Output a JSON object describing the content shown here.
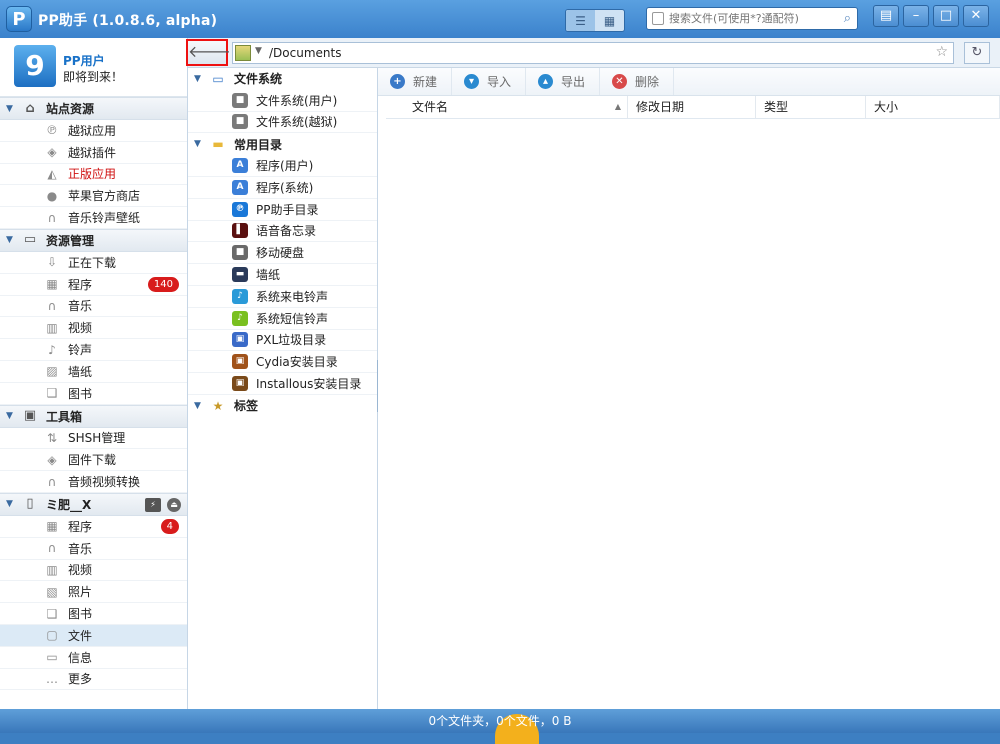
{
  "window": {
    "title": "PP助手 (1.0.8.6, alpha)",
    "logo": "P",
    "search_placeholder": "搜索文件(可使用*?通配符)",
    "controls": [
      "comment-icon",
      "minimize-icon",
      "maximize-icon",
      "close-icon"
    ]
  },
  "user": {
    "name": "PP用户",
    "status": "即将到来！"
  },
  "sidebar": {
    "sections": [
      {
        "title": "站点资源",
        "icon": "home-icon",
        "items": [
          {
            "label": "越狱应用",
            "icon": "pp-icon"
          },
          {
            "label": "越狱插件",
            "icon": "cube-icon"
          },
          {
            "label": "正版应用",
            "icon": "store-icon",
            "highlight": "red"
          },
          {
            "label": "苹果官方商店",
            "icon": "apple-icon"
          },
          {
            "label": "音乐铃声壁纸",
            "icon": "headphones-icon"
          }
        ]
      },
      {
        "title": "资源管理",
        "icon": "monitor-icon",
        "items": [
          {
            "label": "正在下载",
            "icon": "download-icon"
          },
          {
            "label": "程序",
            "icon": "apps-icon",
            "badge": "140"
          },
          {
            "label": "音乐",
            "icon": "headphones-icon"
          },
          {
            "label": "视频",
            "icon": "film-icon"
          },
          {
            "label": "铃声",
            "icon": "note-icon"
          },
          {
            "label": "墙纸",
            "icon": "picture-icon"
          },
          {
            "label": "图书",
            "icon": "book-icon"
          }
        ]
      },
      {
        "title": "工具箱",
        "icon": "toolbox-icon",
        "items": [
          {
            "label": "SHSH管理",
            "icon": "arrows-icon"
          },
          {
            "label": "固件下载",
            "icon": "cube-icon"
          },
          {
            "label": "音频视频转换",
            "icon": "headphones-icon"
          }
        ]
      },
      {
        "title": "ミ肥__X",
        "icon": "phone-icon",
        "device": true,
        "items": [
          {
            "label": "程序",
            "icon": "apps-icon",
            "badge": "4"
          },
          {
            "label": "音乐",
            "icon": "headphones-icon"
          },
          {
            "label": "视频",
            "icon": "film-icon"
          },
          {
            "label": "照片",
            "icon": "photo-icon"
          },
          {
            "label": "图书",
            "icon": "book-icon"
          },
          {
            "label": "文件",
            "icon": "file-icon",
            "selected": true
          },
          {
            "label": "信息",
            "icon": "chat-icon"
          },
          {
            "label": "更多",
            "icon": "more-icon"
          }
        ]
      }
    ]
  },
  "pathbar": {
    "path": "/Documents"
  },
  "tree": {
    "groups": [
      {
        "title": "文件系统",
        "icon": "computer-icon",
        "items": [
          {
            "label": "文件系统(用户)",
            "icon": "disk-lock-icon",
            "color": "#7a7a7a"
          },
          {
            "label": "文件系统(越狱)",
            "icon": "disk-icon",
            "color": "#7a7a7a"
          }
        ]
      },
      {
        "title": "常用目录",
        "icon": "folder-icon",
        "items": [
          {
            "label": "程序(用户)",
            "icon": "appstore-icon",
            "color": "#3b7fd8"
          },
          {
            "label": "程序(系统)",
            "icon": "appstore-icon",
            "color": "#3b7fd8"
          },
          {
            "label": "PP助手目录",
            "icon": "pp-icon",
            "color": "#1a78d8"
          },
          {
            "label": "语音备忘录",
            "icon": "voice-icon",
            "color": "#5a1010"
          },
          {
            "label": "移动硬盘",
            "icon": "hdd-icon",
            "color": "#6a6a6a"
          },
          {
            "label": "墙纸",
            "icon": "wallpaper-icon",
            "color": "#2a3a5a"
          },
          {
            "label": "系统来电铃声",
            "icon": "note-blue-icon",
            "color": "#2a9ad8"
          },
          {
            "label": "系统短信铃声",
            "icon": "note-green-icon",
            "color": "#7ac020"
          },
          {
            "label": "PXL垃圾目录",
            "icon": "trash-icon",
            "color": "#3a6ac8"
          },
          {
            "label": "Cydia安装目录",
            "icon": "cydia-icon",
            "color": "#a0521a"
          },
          {
            "label": "Installous安装目录",
            "icon": "installous-icon",
            "color": "#7a4a1a"
          }
        ]
      },
      {
        "title": "标签",
        "icon": "star-tag-icon",
        "items": []
      }
    ]
  },
  "toolbar": {
    "buttons": [
      {
        "label": "新建",
        "icon": "new-icon",
        "color": "#3a7ac8"
      },
      {
        "label": "导入",
        "icon": "import-icon",
        "color": "#2a8ad0"
      },
      {
        "label": "导出",
        "icon": "export-icon",
        "color": "#2a8ad0"
      },
      {
        "label": "删除",
        "icon": "delete-icon",
        "color": "#d84a4a"
      }
    ]
  },
  "table": {
    "columns": [
      "文件名",
      "修改日期",
      "类型",
      "大小"
    ],
    "rows": []
  },
  "status": {
    "text": "0个文件夹，0个文件，0 B"
  }
}
